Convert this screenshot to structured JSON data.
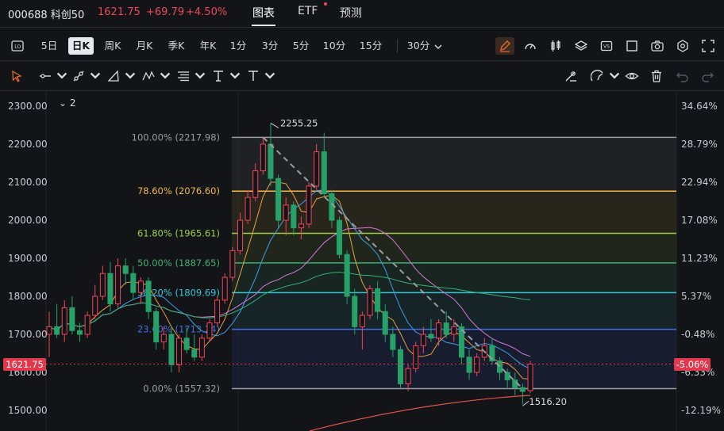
{
  "header": {
    "symbol": "000688 科创50",
    "price": "1621.75",
    "change": "+69.79",
    "change_pct": "+4.50%",
    "tabs": [
      "图表",
      "ETF",
      "预测"
    ]
  },
  "timeframes": {
    "labels": [
      "5日",
      "日K",
      "周K",
      "月K",
      "季K",
      "年K",
      "1分",
      "3分",
      "5分",
      "10分",
      "15分",
      "30分"
    ],
    "active": "日K"
  },
  "collapse_count": "2",
  "current_price_tag": "1621.75",
  "current_pct_tag": "-5.06%",
  "colors": {
    "up": "#f0455a",
    "down": "#26a269",
    "accent": "#e26a2c"
  },
  "chart_data": {
    "type": "candlestick",
    "y_left_ticks": [
      "2300.00",
      "2200.00",
      "2100.00",
      "2000.00",
      "1900.00",
      "1800.00",
      "1700.00",
      "1600.00",
      "1500.00"
    ],
    "y_right_ticks": [
      "34.64%",
      "28.79%",
      "22.94%",
      "17.08%",
      "11.23%",
      "5.37%",
      "-0.48%",
      "-6.33%",
      "-12.19%"
    ],
    "ylim": [
      1470,
      2330
    ],
    "high_label": "2255.25",
    "low_label": "1516.20",
    "fib_levels": [
      {
        "label": "100.00% (2217.98)",
        "value": 2217.98,
        "color": "#9a9ca2"
      },
      {
        "label": "78.60% (2076.60)",
        "value": 2076.6,
        "color": "#f2b84b"
      },
      {
        "label": "61.80% (1965.61)",
        "value": 1965.61,
        "color": "#9bcf4a"
      },
      {
        "label": "50.00% (1887.65)",
        "value": 1887.65,
        "color": "#3fae72"
      },
      {
        "label": "38.20% (1809.69)",
        "value": 1809.69,
        "color": "#35c6d8"
      },
      {
        "label": "23.60% (1713.24)",
        "value": 1713.24,
        "color": "#3f6fe0"
      },
      {
        "label": "0.00% (1557.32)",
        "value": 1557.32,
        "color": "#9a9ca2"
      }
    ],
    "candles": [
      {
        "o": 1700,
        "h": 1760,
        "l": 1640,
        "c": 1720
      },
      {
        "o": 1720,
        "h": 1780,
        "l": 1690,
        "c": 1700
      },
      {
        "o": 1700,
        "h": 1790,
        "l": 1680,
        "c": 1770
      },
      {
        "o": 1770,
        "h": 1800,
        "l": 1700,
        "c": 1710
      },
      {
        "o": 1710,
        "h": 1730,
        "l": 1680,
        "c": 1700
      },
      {
        "o": 1700,
        "h": 1760,
        "l": 1690,
        "c": 1750
      },
      {
        "o": 1750,
        "h": 1830,
        "l": 1740,
        "c": 1800
      },
      {
        "o": 1800,
        "h": 1880,
        "l": 1790,
        "c": 1860
      },
      {
        "o": 1860,
        "h": 1890,
        "l": 1760,
        "c": 1780
      },
      {
        "o": 1780,
        "h": 1900,
        "l": 1770,
        "c": 1880
      },
      {
        "o": 1880,
        "h": 1900,
        "l": 1830,
        "c": 1860
      },
      {
        "o": 1860,
        "h": 1880,
        "l": 1790,
        "c": 1810
      },
      {
        "o": 1810,
        "h": 1850,
        "l": 1780,
        "c": 1840
      },
      {
        "o": 1840,
        "h": 1850,
        "l": 1740,
        "c": 1760
      },
      {
        "o": 1760,
        "h": 1770,
        "l": 1660,
        "c": 1680
      },
      {
        "o": 1680,
        "h": 1720,
        "l": 1660,
        "c": 1700
      },
      {
        "o": 1700,
        "h": 1720,
        "l": 1600,
        "c": 1620
      },
      {
        "o": 1620,
        "h": 1700,
        "l": 1600,
        "c": 1690
      },
      {
        "o": 1690,
        "h": 1720,
        "l": 1650,
        "c": 1660
      },
      {
        "o": 1660,
        "h": 1700,
        "l": 1630,
        "c": 1640
      },
      {
        "o": 1640,
        "h": 1700,
        "l": 1630,
        "c": 1690
      },
      {
        "o": 1690,
        "h": 1740,
        "l": 1680,
        "c": 1730
      },
      {
        "o": 1730,
        "h": 1800,
        "l": 1720,
        "c": 1790
      },
      {
        "o": 1790,
        "h": 1860,
        "l": 1780,
        "c": 1850
      },
      {
        "o": 1850,
        "h": 1930,
        "l": 1840,
        "c": 1920
      },
      {
        "o": 1920,
        "h": 2020,
        "l": 1910,
        "c": 2000
      },
      {
        "o": 2000,
        "h": 2080,
        "l": 1990,
        "c": 2060
      },
      {
        "o": 2060,
        "h": 2150,
        "l": 2050,
        "c": 2130
      },
      {
        "o": 2130,
        "h": 2220,
        "l": 2120,
        "c": 2200
      },
      {
        "o": 2200,
        "h": 2255,
        "l": 2090,
        "c": 2110
      },
      {
        "o": 2110,
        "h": 2120,
        "l": 1980,
        "c": 2000
      },
      {
        "o": 2000,
        "h": 2060,
        "l": 1960,
        "c": 2040
      },
      {
        "o": 2040,
        "h": 2050,
        "l": 1960,
        "c": 1980
      },
      {
        "o": 1980,
        "h": 2010,
        "l": 1950,
        "c": 1990
      },
      {
        "o": 1990,
        "h": 2100,
        "l": 1980,
        "c": 2090
      },
      {
        "o": 2090,
        "h": 2200,
        "l": 2080,
        "c": 2180
      },
      {
        "o": 2180,
        "h": 2230,
        "l": 2060,
        "c": 2070
      },
      {
        "o": 2070,
        "h": 2080,
        "l": 1980,
        "c": 2000
      },
      {
        "o": 2000,
        "h": 2010,
        "l": 1900,
        "c": 1910
      },
      {
        "o": 1910,
        "h": 1920,
        "l": 1780,
        "c": 1800
      },
      {
        "o": 1800,
        "h": 1820,
        "l": 1700,
        "c": 1720
      },
      {
        "o": 1720,
        "h": 1760,
        "l": 1660,
        "c": 1750
      },
      {
        "o": 1750,
        "h": 1830,
        "l": 1740,
        "c": 1820
      },
      {
        "o": 1820,
        "h": 1840,
        "l": 1740,
        "c": 1760
      },
      {
        "o": 1760,
        "h": 1780,
        "l": 1680,
        "c": 1700
      },
      {
        "o": 1700,
        "h": 1720,
        "l": 1640,
        "c": 1660
      },
      {
        "o": 1660,
        "h": 1670,
        "l": 1560,
        "c": 1570
      },
      {
        "o": 1570,
        "h": 1620,
        "l": 1550,
        "c": 1610
      },
      {
        "o": 1610,
        "h": 1680,
        "l": 1600,
        "c": 1670
      },
      {
        "o": 1670,
        "h": 1720,
        "l": 1650,
        "c": 1700
      },
      {
        "o": 1700,
        "h": 1740,
        "l": 1680,
        "c": 1690
      },
      {
        "o": 1690,
        "h": 1740,
        "l": 1670,
        "c": 1730
      },
      {
        "o": 1730,
        "h": 1760,
        "l": 1690,
        "c": 1700
      },
      {
        "o": 1700,
        "h": 1740,
        "l": 1680,
        "c": 1720
      },
      {
        "o": 1720,
        "h": 1730,
        "l": 1620,
        "c": 1640
      },
      {
        "o": 1640,
        "h": 1660,
        "l": 1580,
        "c": 1600
      },
      {
        "o": 1600,
        "h": 1650,
        "l": 1590,
        "c": 1640
      },
      {
        "o": 1640,
        "h": 1690,
        "l": 1630,
        "c": 1670
      },
      {
        "o": 1670,
        "h": 1690,
        "l": 1620,
        "c": 1630
      },
      {
        "o": 1630,
        "h": 1640,
        "l": 1580,
        "c": 1600
      },
      {
        "o": 1600,
        "h": 1610,
        "l": 1560,
        "c": 1580
      },
      {
        "o": 1580,
        "h": 1600,
        "l": 1540,
        "c": 1560
      },
      {
        "o": 1560,
        "h": 1570,
        "l": 1516,
        "c": 1550
      },
      {
        "o": 1552,
        "h": 1630,
        "l": 1545,
        "c": 1621.75
      }
    ]
  }
}
